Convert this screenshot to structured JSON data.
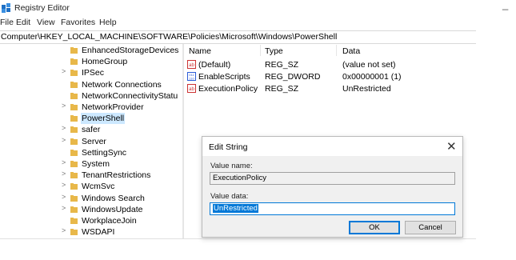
{
  "window": {
    "title": "Registry Editor",
    "close_glyph": "_"
  },
  "menu": [
    "File",
    "Edit",
    "View",
    "Favorites",
    "Help"
  ],
  "address": "Computer\\HKEY_LOCAL_MACHINE\\SOFTWARE\\Policies\\Microsoft\\Windows\\PowerShell",
  "tree": {
    "items": [
      {
        "label": "EnhancedStorageDevices",
        "expander": ""
      },
      {
        "label": "HomeGroup",
        "expander": ""
      },
      {
        "label": "IPSec",
        "expander": ">"
      },
      {
        "label": "Network Connections",
        "expander": ""
      },
      {
        "label": "NetworkConnectivityStatu",
        "expander": ""
      },
      {
        "label": "NetworkProvider",
        "expander": ">"
      },
      {
        "label": "PowerShell",
        "expander": "",
        "selected": true
      },
      {
        "label": "safer",
        "expander": ">"
      },
      {
        "label": "Server",
        "expander": ">"
      },
      {
        "label": "SettingSync",
        "expander": ""
      },
      {
        "label": "System",
        "expander": ">"
      },
      {
        "label": "TenantRestrictions",
        "expander": ">"
      },
      {
        "label": "WcmSvc",
        "expander": ">"
      },
      {
        "label": "Windows Search",
        "expander": ">"
      },
      {
        "label": "WindowsUpdate",
        "expander": ">"
      },
      {
        "label": "WorkplaceJoin",
        "expander": ""
      },
      {
        "label": "WSDAPI",
        "expander": ">"
      }
    ]
  },
  "list": {
    "headers": {
      "name": "Name",
      "type": "Type",
      "data": "Data"
    },
    "rows": [
      {
        "name": "(Default)",
        "type": "REG_SZ",
        "data": "(value not set)",
        "icon": "string-value-icon"
      },
      {
        "name": "EnableScripts",
        "type": "REG_DWORD",
        "data": "0x00000001 (1)",
        "icon": "binary-value-icon"
      },
      {
        "name": "ExecutionPolicy",
        "type": "REG_SZ",
        "data": "UnRestricted",
        "icon": "string-value-icon"
      }
    ]
  },
  "dialog": {
    "title": "Edit String",
    "close_glyph": "✕",
    "value_name_label": "Value name:",
    "value_name": "ExecutionPolicy",
    "value_data_label": "Value data:",
    "value_data": "UnRestricted",
    "ok_label": "OK",
    "cancel_label": "Cancel"
  },
  "colors": {
    "accent": "#0078d7",
    "selection": "#cce8ff",
    "folder": "#e8b84a"
  }
}
